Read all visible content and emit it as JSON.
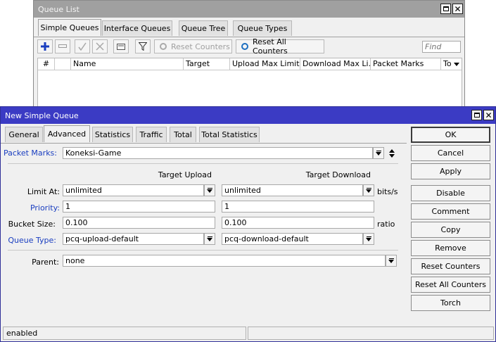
{
  "queue_list": {
    "title": "Queue List",
    "tabs": [
      {
        "label": "Simple Queues"
      },
      {
        "label": "Interface Queues"
      },
      {
        "label": "Queue Tree"
      },
      {
        "label": "Queue Types"
      }
    ],
    "toolbar": {
      "reset_counters": "Reset Counters",
      "reset_all_counters": "Reset All Counters",
      "find_placeholder": "Find"
    },
    "columns": [
      "#",
      "",
      "Name",
      "Target",
      "Upload Max Limit",
      "Download Max Li...",
      "Packet Marks",
      "To"
    ]
  },
  "dialog": {
    "title": "New Simple Queue",
    "tabs": [
      {
        "label": "General"
      },
      {
        "label": "Advanced"
      },
      {
        "label": "Statistics"
      },
      {
        "label": "Traffic"
      },
      {
        "label": "Total"
      },
      {
        "label": "Total Statistics"
      }
    ],
    "packet_marks": {
      "label": "Packet Marks:",
      "value": "Koneksi-Game"
    },
    "headers": {
      "upload": "Target Upload",
      "download": "Target Download"
    },
    "limit_at": {
      "label": "Limit At:",
      "upload": "unlimited",
      "download": "unlimited",
      "unit": "bits/s"
    },
    "priority": {
      "label": "Priority:",
      "upload": "1",
      "download": "1"
    },
    "bucket_size": {
      "label": "Bucket Size:",
      "upload": "0.100",
      "download": "0.100",
      "unit": "ratio"
    },
    "queue_type": {
      "label": "Queue Type:",
      "upload": "pcq-upload-default",
      "download": "pcq-download-default"
    },
    "parent": {
      "label": "Parent:",
      "value": "none"
    },
    "buttons": {
      "ok": "OK",
      "cancel": "Cancel",
      "apply": "Apply",
      "disable": "Disable",
      "comment": "Comment",
      "copy": "Copy",
      "remove": "Remove",
      "reset_counters": "Reset Counters",
      "reset_all_counters": "Reset All Counters",
      "torch": "Torch"
    },
    "status": "enabled"
  },
  "colors": {
    "dialog_title_bar": "#3b3bc4",
    "inactive_title_bar": "#a0a0a0",
    "label_link": "#1a3ec0",
    "add_icon": "#1b3fbf",
    "reset_icon": "#1d6fc0"
  },
  "icons": [
    "add-icon",
    "remove-icon",
    "enable-icon",
    "disable-icon",
    "comment-icon",
    "filter-icon",
    "reset-icon",
    "maximize-icon",
    "close-icon",
    "dropdown-icon",
    "up-down-icon"
  ]
}
